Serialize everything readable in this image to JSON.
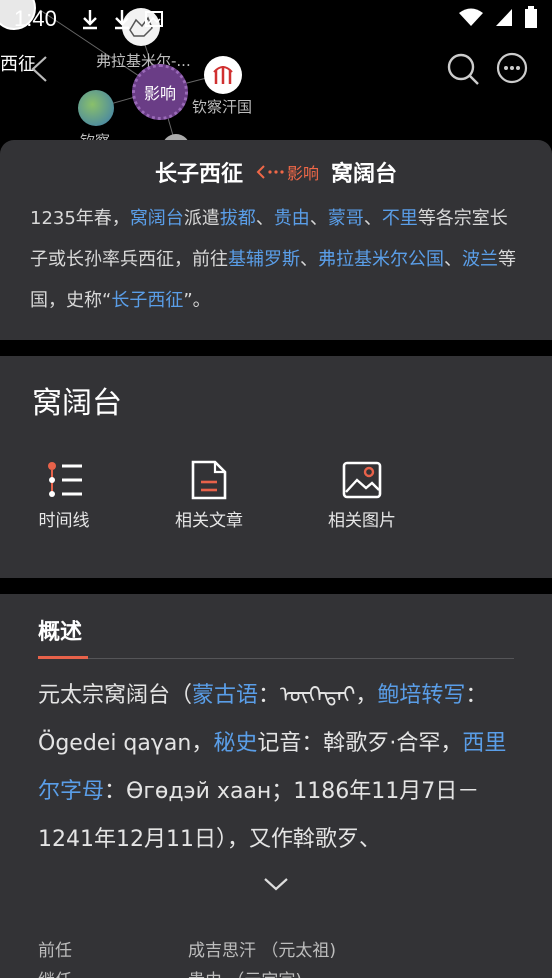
{
  "status_bar": {
    "time": "1:40"
  },
  "graph": {
    "nodes": {
      "west_partial": "西征",
      "fulamier": "弗拉基米尔-...",
      "influence": "影响",
      "qincha": "钦察汗国",
      "qincha_partial": "钦察"
    }
  },
  "header": {
    "back_icon": "chevron-left-icon",
    "search_icon": "search-icon",
    "more_icon": "more-icon"
  },
  "relation": {
    "left": "长子西征",
    "badge": "影响",
    "right": "窝阔台",
    "body": {
      "t1": "1235年春，",
      "l1": "窝阔台",
      "t2": "派遣",
      "l2": "拔都",
      "t3": "、",
      "l3": "贵由",
      "t4": "、",
      "l4": "蒙哥",
      "t5": "、",
      "l5": "不里",
      "t6": "等各宗室长子或长孙率兵西征，前往",
      "l6": "基辅罗斯",
      "t7": "、",
      "l7": "弗拉基米尔公国",
      "t8": "、",
      "l8": "波兰",
      "t9": "等国，史称“",
      "l9": "长子西征",
      "t10": "”。"
    }
  },
  "entity": {
    "name": "窝阔台",
    "actions": [
      "时间线",
      "相关文章",
      "相关图片"
    ]
  },
  "overview": {
    "title": "概述",
    "body": {
      "t1": "元太宗窝阔台（",
      "l1": "蒙古语",
      "t2": "：ᠥᠭᠡᠳᠡᠢ，",
      "l2": "鲍培转写",
      "t3": "：Ögedei qaγan，",
      "l3": "秘史",
      "t4": "记音：斡歌歹·合罕，",
      "l4": "西里尔字母",
      "t5": "：Өгөдэй хаан；1186年11月7日－1241年12月11日），又作斡歌歹、"
    },
    "info": [
      {
        "k": "前任",
        "v": "成吉思汗 （元太祖)"
      },
      {
        "k": "继任",
        "v": "贵由 （元定宗)"
      }
    ]
  },
  "colors": {
    "accent": "#e8624a",
    "link": "#5a9ee8",
    "card": "#333336",
    "node": "#6a3d86"
  }
}
